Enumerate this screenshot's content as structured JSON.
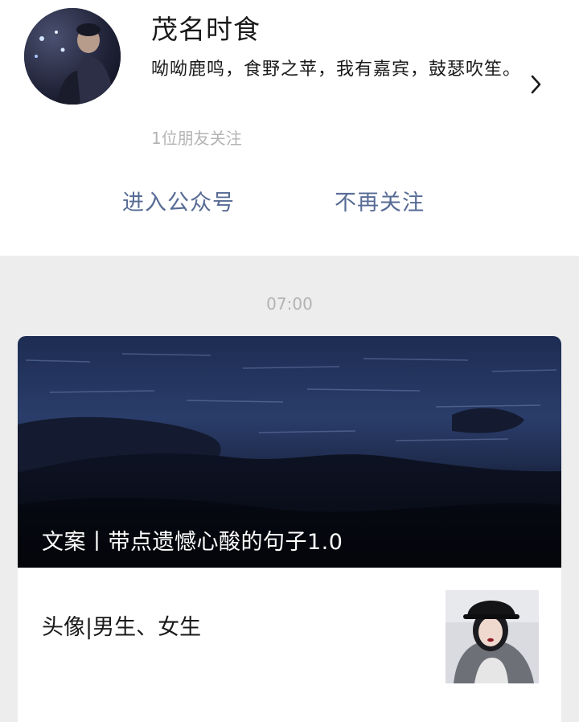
{
  "account": {
    "name": "茂名时食",
    "description": "呦呦鹿鸣，食野之苹，我有嘉宾，鼓瑟吹笙。",
    "followers_text": "1位朋友关注"
  },
  "actions": {
    "enter_label": "进入公众号",
    "unfollow_label": "不再关注"
  },
  "message": {
    "time": "07:00",
    "cover_title": "文案丨带点遗憾心酸的句子1.0",
    "articles": [
      {
        "title": "头像|男生、女生"
      }
    ]
  },
  "icons": {
    "chevron": "chevron-right-icon"
  },
  "colors": {
    "link": "#576b95",
    "background": "#ededed",
    "secondary_text": "#b4b4b4"
  }
}
